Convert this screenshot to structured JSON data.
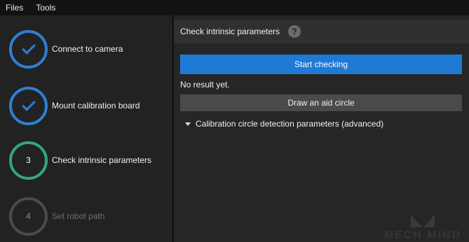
{
  "menubar": {
    "items": [
      {
        "label": "Files"
      },
      {
        "label": "Tools"
      }
    ]
  },
  "steps": [
    {
      "label": "Connect to camera",
      "state": "done",
      "icon": "check-icon"
    },
    {
      "label": "Mount calibration board",
      "state": "done",
      "icon": "check-icon"
    },
    {
      "label": "Check intrinsic parameters",
      "state": "current",
      "number": "3"
    },
    {
      "label": "Set robot path",
      "state": "pending",
      "number": "4"
    }
  ],
  "panel": {
    "title": "Check intrinsic parameters",
    "help_icon": "?",
    "start_button": "Start checking",
    "status_text": "No result yet.",
    "aid_circle_button": "Draw an aid circle",
    "advanced_section": "Calibration circle detection parameters (advanced)"
  },
  "watermark": {
    "text": "MECH MIND"
  },
  "colors": {
    "accent": "#1f7ad6",
    "done": "#2d7fd3",
    "current": "#34a678",
    "pending": "#4b4b4b"
  }
}
